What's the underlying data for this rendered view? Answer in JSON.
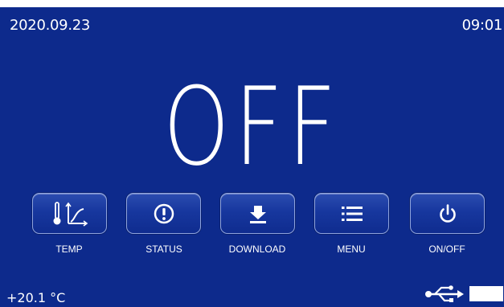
{
  "status_bar": {
    "date": "2020.09.23",
    "time": "09:01"
  },
  "main": {
    "state": "OFF"
  },
  "buttons": [
    {
      "label": "TEMP",
      "icon": "thermometer-graph-icon"
    },
    {
      "label": "STATUS",
      "icon": "alert-circle-icon"
    },
    {
      "label": "DOWNLOAD",
      "icon": "download-icon"
    },
    {
      "label": "MENU",
      "icon": "menu-list-icon"
    },
    {
      "label": "ON/OFF",
      "icon": "power-icon"
    }
  ],
  "footer": {
    "temperature": "+20.1 °C",
    "usb_icon": "usb-icon",
    "battery_icon": "battery-icon"
  },
  "colors": {
    "background": "#0d2a8c",
    "button": "#17379e",
    "text": "#ffffff"
  }
}
